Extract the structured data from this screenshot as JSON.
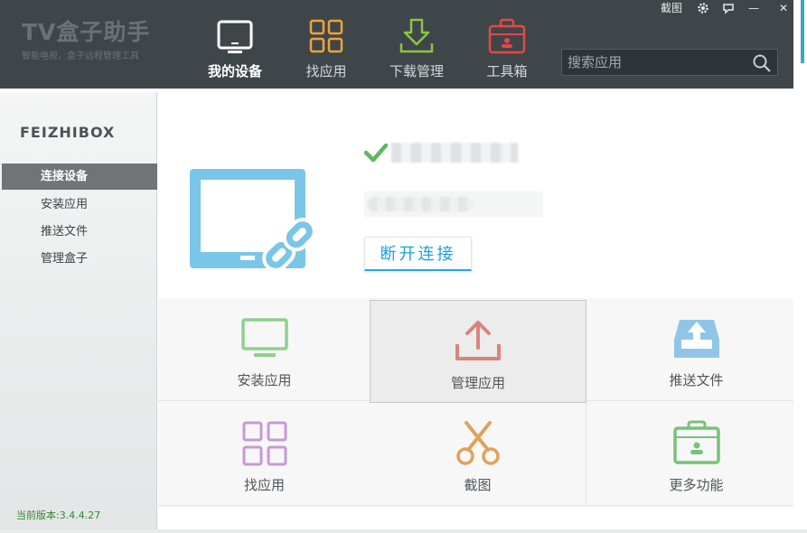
{
  "app": {
    "title": "TV盒子助手",
    "subtitle": "智能电视，盒子远程管理工具"
  },
  "window_controls": {
    "screenshot_label": "截图",
    "settings_icon": "gear-icon",
    "feedback_icon": "chat-bubble-icon",
    "minimize_label": "—",
    "close_label": "✕"
  },
  "nav": [
    {
      "label": "我的设备",
      "icon": "tv-icon",
      "active": true
    },
    {
      "label": "找应用",
      "icon": "app-grid-icon",
      "active": false
    },
    {
      "label": "下载管理",
      "icon": "download-icon",
      "active": false
    },
    {
      "label": "工具箱",
      "icon": "toolbox-icon",
      "active": false
    }
  ],
  "search": {
    "placeholder": "搜索应用",
    "icon": "search-icon"
  },
  "sidebar": {
    "title": "FEIZHIBOX",
    "items": [
      {
        "label": "连接设备",
        "active": true
      },
      {
        "label": "安装应用",
        "active": false
      },
      {
        "label": "推送文件",
        "active": false
      },
      {
        "label": "管理盒子",
        "active": false
      }
    ],
    "version": "当前版本:3.4.4.27"
  },
  "device": {
    "status_icon": "check-icon",
    "illustration": "tv-link-icon",
    "disconnect_label": "断开连接"
  },
  "tiles": [
    {
      "label": "安装应用",
      "icon": "monitor-icon",
      "color": "#8dd08d"
    },
    {
      "label": "管理应用",
      "icon": "upload-icon",
      "color": "#d9847c"
    },
    {
      "label": "推送文件",
      "icon": "inbox-push-icon",
      "color": "#8fc6e8"
    },
    {
      "label": "找应用",
      "icon": "app-grid-icon",
      "color": "#c69ad6"
    },
    {
      "label": "截图",
      "icon": "scissors-icon",
      "color": "#e0a25a"
    },
    {
      "label": "更多功能",
      "icon": "briefcase-icon",
      "color": "#79c279"
    }
  ],
  "colors": {
    "topbar": "#3f4649",
    "accent_blue": "#1e9fe0",
    "sidebar_active": "#6f7577",
    "nav_grid_orange": "#f0a23a",
    "nav_download_green": "#8cc63e",
    "nav_toolbox_red": "#e04a47"
  }
}
